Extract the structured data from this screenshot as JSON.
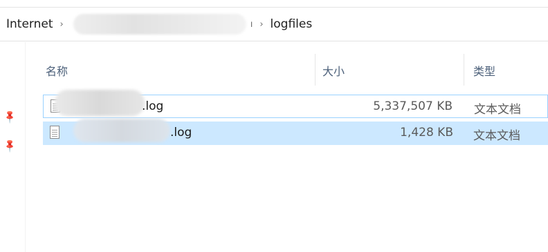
{
  "address_bar": {
    "root": "Internet",
    "separator": "›",
    "current": "logfiles",
    "redacted_tail": "ı"
  },
  "columns": {
    "name": "名称",
    "size": "大小",
    "type": "类型"
  },
  "files": [
    {
      "name_suffix": ".log",
      "size": "5,337,507 KB",
      "type": "文本文档"
    },
    {
      "name_suffix": ".log",
      "size": "1,428 KB",
      "type": "文本文档"
    }
  ],
  "icons": {
    "pin": "pin-icon",
    "file": "text-document-icon",
    "chevron": "chevron-right-icon"
  },
  "colors": {
    "selected_row_background": "#cce8ff",
    "focus_row_border": "#99d1ff",
    "header_text": "#4c607a"
  }
}
